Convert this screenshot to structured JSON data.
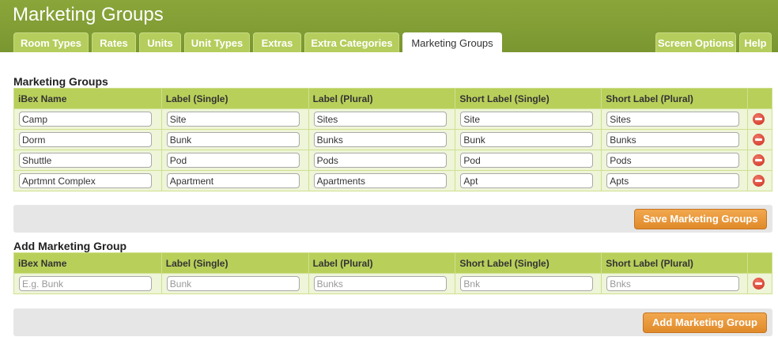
{
  "page_title": "Marketing Groups",
  "tabs": [
    "Room Types",
    "Rates",
    "Units",
    "Unit Types",
    "Extras",
    "Extra Categories",
    "Marketing Groups"
  ],
  "right_tabs": [
    "Screen Options",
    "Help"
  ],
  "marketing_groups": {
    "title": "Marketing Groups",
    "columns": [
      "iBex Name",
      "Label (Single)",
      "Label (Plural)",
      "Short Label (Single)",
      "Short Label (Plural)"
    ],
    "rows": [
      [
        "Camp",
        "Site",
        "Sites",
        "Site",
        "Sites"
      ],
      [
        "Dorm",
        "Bunk",
        "Bunks",
        "Bunk",
        "Bunks"
      ],
      [
        "Shuttle",
        "Pod",
        "Pods",
        "Pod",
        "Pods"
      ],
      [
        "Aprtmnt Complex",
        "Apartment",
        "Apartments",
        "Apt",
        "Apts"
      ]
    ],
    "save_label": "Save Marketing Groups"
  },
  "add_group": {
    "title": "Add Marketing Group",
    "columns": [
      "iBex Name",
      "Label (Single)",
      "Label (Plural)",
      "Short Label (Single)",
      "Short Label (Plural)"
    ],
    "placeholders": [
      "E.g. Bunk",
      "Bunk",
      "Bunks",
      "Bnk",
      "Bnks"
    ],
    "add_label": "Add Marketing Group"
  },
  "colors": {
    "header_green": "#7f9b33",
    "tab_green": "#b5cd5c",
    "row_bg": "#eef5d8",
    "button_orange": "#e8962e"
  }
}
